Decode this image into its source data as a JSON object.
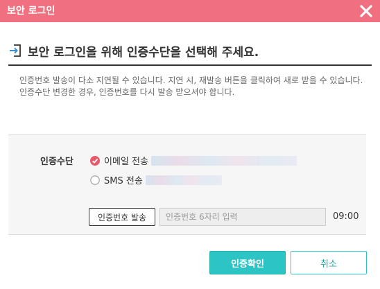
{
  "dialog": {
    "title": "보안 로그인",
    "heading": "보안 로그인을 위해 인증수단을 선택해 주세요.",
    "description": "인증번호 발송이 다소 지연될 수 있습니다. 지연 시, 재발송 버튼을 클릭하여 새로 받을 수 있습니다. 인증수단 변경한 경우, 인증번호를 다시 발송 받으셔야 합니다."
  },
  "auth": {
    "label": "인증수단",
    "options": [
      {
        "label": "이메일 전송",
        "selected": true
      },
      {
        "label": "SMS 전송",
        "selected": false
      }
    ],
    "send_button": "인증번호 발송",
    "code_placeholder": "인증번호 6자리 입력",
    "timer": "09:00"
  },
  "footer": {
    "confirm_button": "인증확인",
    "cancel_button": "취소"
  },
  "colors": {
    "titlebar": "#f07080",
    "accent": "#2cc4c4",
    "radio_checked": "#e85a6a"
  }
}
